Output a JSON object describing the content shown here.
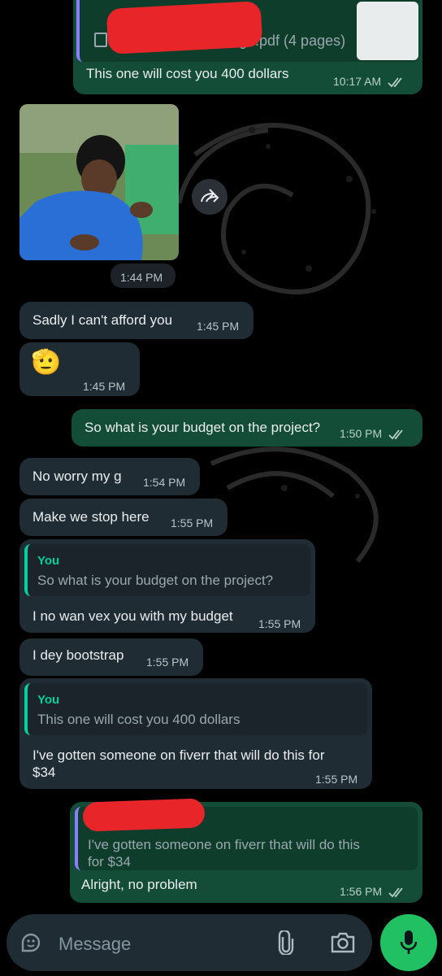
{
  "messages": {
    "m1": {
      "file_name_visible": "ge.pdf (4 pages)",
      "text": "This one will cost you 400 dollars",
      "time": "10:17 AM"
    },
    "m2": {
      "time": "1:44 PM"
    },
    "m3": {
      "text": "Sadly I can't afford you",
      "time": "1:45 PM"
    },
    "m4": {
      "emoji": "🫡",
      "time": "1:45 PM"
    },
    "m5": {
      "text": "So what is your budget on the project?",
      "time": "1:50 PM"
    },
    "m6": {
      "text": "No worry my g",
      "time": "1:54 PM"
    },
    "m7": {
      "text": "Make we stop here",
      "time": "1:55 PM"
    },
    "m8": {
      "quote_name": "You",
      "quote_text": "So what is your budget on the project?",
      "text": "I no wan vex you with my budget",
      "time": "1:55 PM"
    },
    "m9": {
      "text": "I dey bootstrap",
      "time": "1:55 PM"
    },
    "m10": {
      "quote_name": "You",
      "quote_text": "This one will cost you 400 dollars",
      "text_line1": "I've gotten someone on fiverr that will do this for",
      "text_line2": "$34",
      "time": "1:55 PM"
    },
    "m11": {
      "quote_text_line1": "I've gotten someone on fiverr that will do this",
      "quote_text_line2": "for $34",
      "text": "Alright, no problem",
      "time": "1:56 PM"
    }
  },
  "input": {
    "placeholder": "Message"
  },
  "colors": {
    "incoming_bubble": "#202c33",
    "outgoing_bubble": "#144d37",
    "accent_green": "#06cf9c",
    "mic_button": "#21c063",
    "redaction": "#e8262a"
  },
  "icons": [
    "forward-icon",
    "double-check-icon",
    "sticker-icon",
    "attach-icon",
    "camera-icon",
    "mic-icon",
    "document-icon"
  ]
}
